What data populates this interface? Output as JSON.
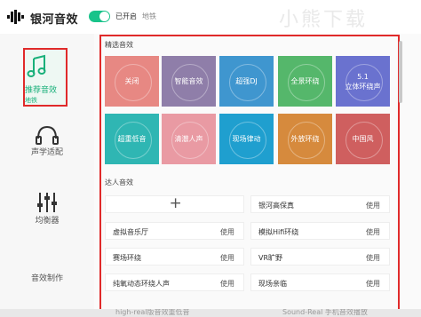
{
  "header": {
    "app_title": "银河音效",
    "toggle_label": "已开启",
    "toggle_sub": "地铁",
    "watermark": "小熊下载"
  },
  "sidebar": {
    "items": [
      {
        "label": "推荐音效",
        "sub": "地铁"
      },
      {
        "label": "声学适配"
      },
      {
        "label": "均衡器"
      },
      {
        "label": "音效制作"
      }
    ]
  },
  "content": {
    "featured_title": "精选音效",
    "tiles": [
      {
        "label": "关闭",
        "color": "#e78883"
      },
      {
        "label": "智能音效",
        "color": "#8f7ea9"
      },
      {
        "label": "超强DJ",
        "color": "#3f96cf"
      },
      {
        "label": "全景环绕",
        "color": "#55b76b"
      },
      {
        "label": "5.1\n立体环绕声",
        "color": "#6a72cf"
      },
      {
        "label": "超重低音",
        "color": "#2fb6b3"
      },
      {
        "label": "清澈人声",
        "color": "#e99aa3"
      },
      {
        "label": "现场律动",
        "color": "#1f9fcf"
      },
      {
        "label": "外放环绕",
        "color": "#d68a3d"
      },
      {
        "label": "中国风",
        "color": "#cf5f5f"
      }
    ],
    "expert_title": "达人音效",
    "experts": [
      {
        "name": "",
        "use": ""
      },
      {
        "name": "银河高保真",
        "use": "使用"
      },
      {
        "name": "虚拟音乐厅",
        "use": "使用"
      },
      {
        "name": "模拟Hifi环绕",
        "use": "使用"
      },
      {
        "name": "赛场环绕",
        "use": "使用"
      },
      {
        "name": "VR旷野",
        "use": "使用"
      },
      {
        "name": "纯氧动态环绕人声",
        "use": "使用"
      },
      {
        "name": "现场亲临",
        "use": "使用"
      }
    ]
  },
  "bottom": {
    "left_text": "high-real版音效重低音",
    "right_text": "Sound-Real 手机音效播放"
  },
  "colors": {
    "accent": "#19c38a",
    "highlight_border": "#e02a2a"
  }
}
